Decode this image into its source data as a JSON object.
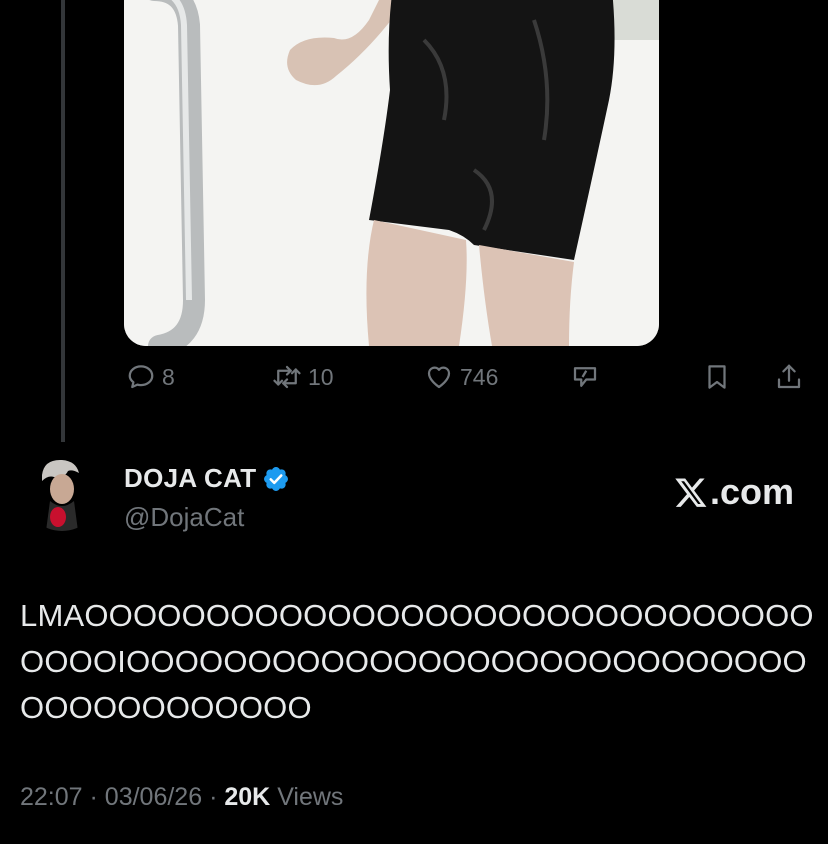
{
  "tweet_actions": {
    "reply_count": "8",
    "retweet_count": "10",
    "like_count": "746",
    "icons": [
      "reply-icon",
      "retweet-icon",
      "like-icon",
      "grok-icon",
      "bookmark-icon",
      "share-icon"
    ]
  },
  "author": {
    "display_name": "DOJA CAT",
    "handle": "@DojaCat",
    "verified": true,
    "verified_color": "#1d9bf0"
  },
  "brand": {
    "suffix": ".com"
  },
  "tweet": {
    "text": "LMAOOOOOOOOOOOOOOOOOOOOOOOOOOOOOOOOOOIOOOOOOOOOOOOOOOOOOOOOOOOOOOOOOOOOOOOOOOO"
  },
  "meta": {
    "time": "22:07",
    "date": "03/06/26",
    "views_count": "20K",
    "views_label": "Views",
    "separator": "·"
  },
  "colors": {
    "background": "#000000",
    "text": "#e7e9ea",
    "muted": "#71767b"
  }
}
